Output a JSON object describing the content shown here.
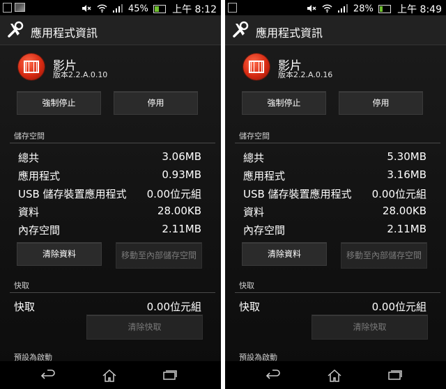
{
  "screens": [
    {
      "status": {
        "battery_percent": "45%",
        "time": "上午 8:12"
      },
      "action_bar_title": "應用程式資訊",
      "app": {
        "name": "影片",
        "version": "版本2.2.A.0.10"
      },
      "buttons": {
        "force_stop": "強制停止",
        "disable": "停用",
        "clear_data": "清除資料",
        "move_to_internal": "移動至內部儲存空間",
        "clear_cache": "清除快取"
      },
      "storage": {
        "header": "儲存空間",
        "rows": [
          {
            "label": "總共",
            "value": "3.06MB"
          },
          {
            "label": "應用程式",
            "value": "0.93MB"
          },
          {
            "label": "USB 儲存裝置應用程式",
            "value": "0.00位元組"
          },
          {
            "label": "資料",
            "value": "28.00KB"
          },
          {
            "label": "內存空間",
            "value": "2.11MB"
          }
        ]
      },
      "cache": {
        "header": "快取",
        "label": "快取",
        "value": "0.00位元組"
      },
      "defaults_header": "預設為啟動"
    },
    {
      "status": {
        "battery_percent": "28%",
        "time": "上午 8:49"
      },
      "action_bar_title": "應用程式資訊",
      "app": {
        "name": "影片",
        "version": "版本2.2.A.0.16"
      },
      "buttons": {
        "force_stop": "強制停止",
        "disable": "停用",
        "clear_data": "清除資料",
        "move_to_internal": "移動至內部儲存空間",
        "clear_cache": "清除快取"
      },
      "storage": {
        "header": "儲存空間",
        "rows": [
          {
            "label": "總共",
            "value": "5.30MB"
          },
          {
            "label": "應用程式",
            "value": "3.16MB"
          },
          {
            "label": "USB 儲存裝置應用程式",
            "value": "0.00位元組"
          },
          {
            "label": "資料",
            "value": "28.00KB"
          },
          {
            "label": "內存空間",
            "value": "2.11MB"
          }
        ]
      },
      "cache": {
        "header": "快取",
        "label": "快取",
        "value": "0.00位元組"
      },
      "defaults_header": "預設為啟動"
    }
  ],
  "icons": {
    "status_left": [
      "notification-icon",
      "image-icon"
    ],
    "status_right": [
      "mute-icon",
      "wifi-icon",
      "signal-icon",
      "battery-icon"
    ],
    "action_bar": "tools-icon",
    "app": "film-icon",
    "nav": [
      "back-icon",
      "home-icon",
      "recent-apps-icon"
    ]
  },
  "colors": {
    "app_icon_red": "#d62a12",
    "battery_green": "#6fbf2f",
    "background": "#161616"
  }
}
